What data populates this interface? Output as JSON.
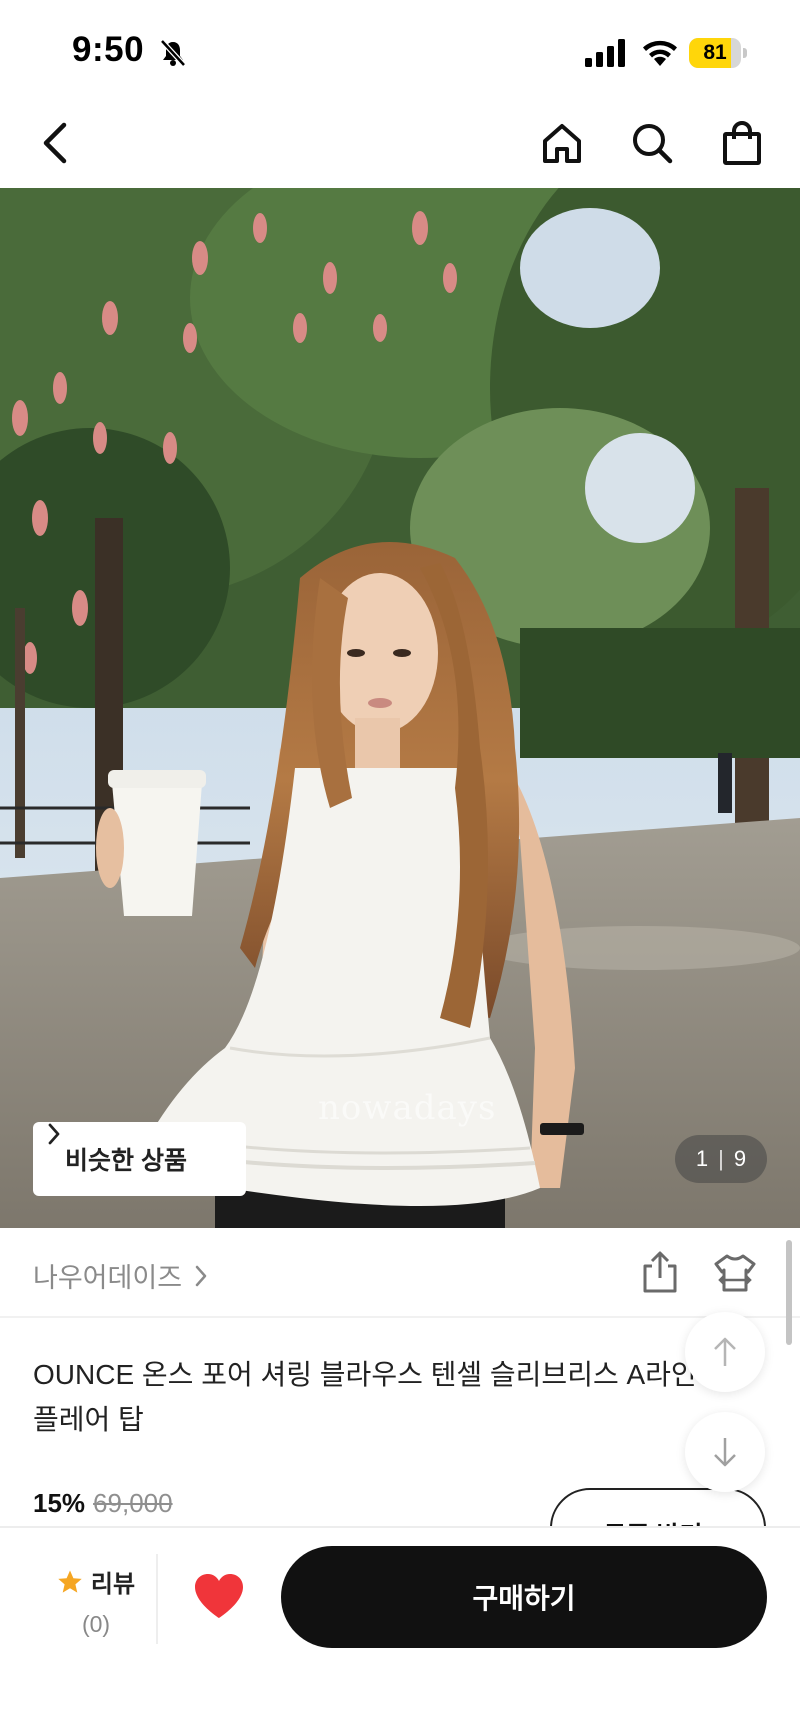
{
  "status_bar": {
    "time": "9:50",
    "battery": "81",
    "battery_level": 0.81,
    "icons": [
      "bell-off-icon",
      "signal-icon",
      "wifi-icon",
      "battery-icon"
    ]
  },
  "nav": {
    "icons": [
      "back-icon",
      "home-icon",
      "search-icon",
      "shopping-bag-icon"
    ]
  },
  "hero": {
    "similar_button": "비슷한 상품",
    "counter_current": "1",
    "counter_separator": "|",
    "counter_total": "9",
    "watermark": "nowadays"
  },
  "brand": {
    "name": "나우어데이즈",
    "icons": [
      "share-icon",
      "fit-icon"
    ]
  },
  "product": {
    "title": "OUNCE 온스 포어 셔링 블라우스 텐셀 슬리브리스 A라인 플레어 탑",
    "discount": "15%",
    "original_price": "69,000",
    "coupon_button": "+ 쿠폰 받기"
  },
  "float_buttons": [
    "arrow-up-icon",
    "arrow-down-icon"
  ],
  "bottom_bar": {
    "review_label": "리뷰",
    "review_count": "(0)",
    "buy_button": "구매하기",
    "colors": {
      "star": "#f5a623",
      "heart": "#f0353a",
      "buy_bg": "#111111"
    }
  }
}
